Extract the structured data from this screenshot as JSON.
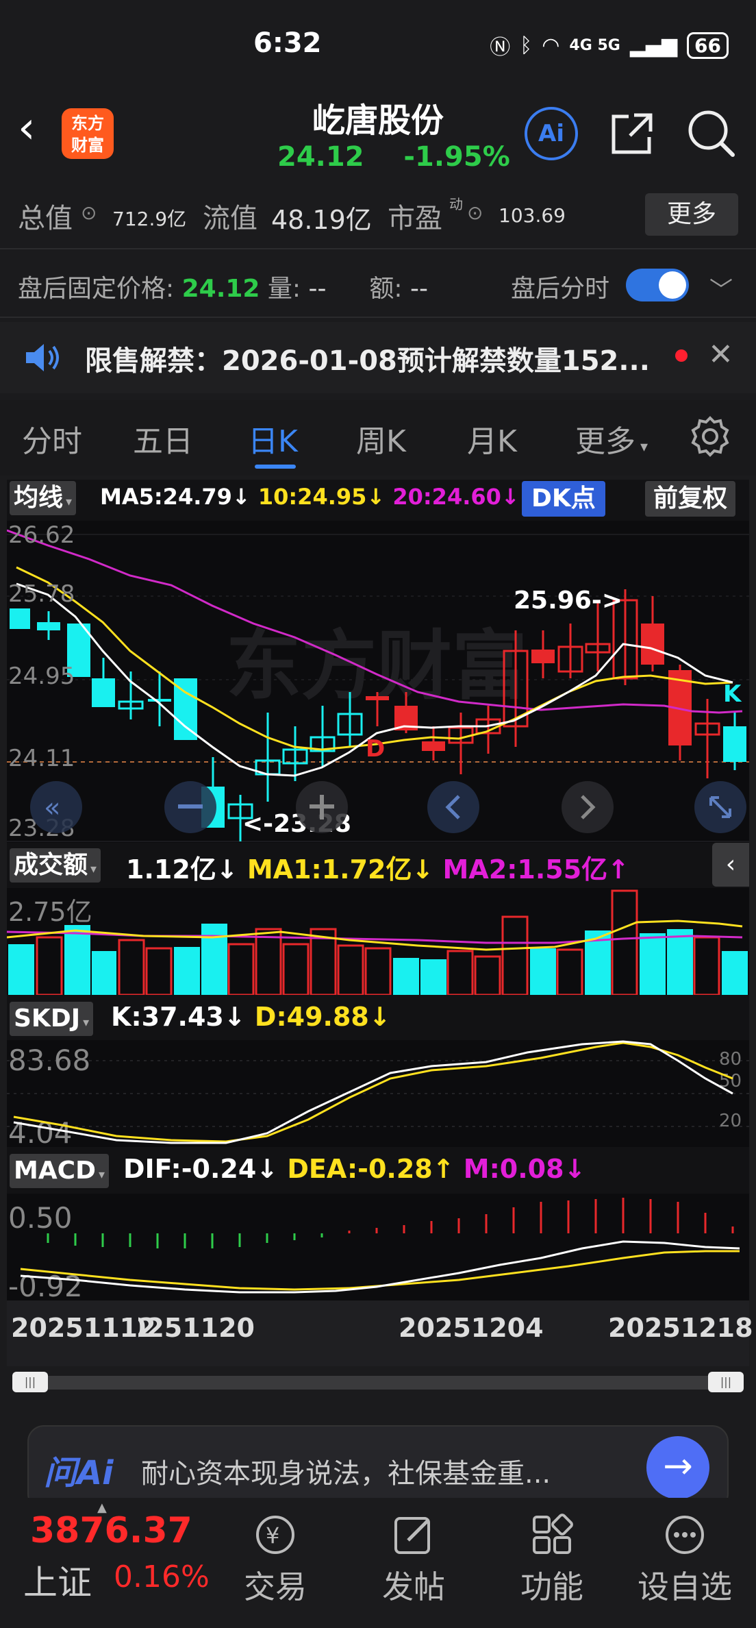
{
  "status_bar": {
    "time": "6:32",
    "network": "4G  5G",
    "battery": "66"
  },
  "header": {
    "stock_name": "屹唐股份",
    "price": "24.12",
    "change_pct": "-1.95%",
    "logo_line1": "东方",
    "logo_line2": "财富",
    "ai_label": "Ai"
  },
  "metrics": {
    "total_value_label": "总值",
    "total_value": "712.9亿",
    "float_value_label": "流值",
    "float_value": "48.19亿",
    "pe_label": "市盈",
    "pe_sup": "动",
    "pe_value": "103.69",
    "more_button": "更多"
  },
  "after_hours": {
    "fixed_price_label": "盘后固定价格:",
    "fixed_price": "24.12",
    "volume_label": "量:",
    "volume": "--",
    "amount_label": "额:",
    "amount": "--",
    "toggle_label": "盘后分时"
  },
  "notice": {
    "text": "限售解禁：2026-01-08预计解禁数量152..."
  },
  "tabs": [
    "分时",
    "五日",
    "日K",
    "周K",
    "月K",
    "更多"
  ],
  "kline_header": {
    "selector": "均线",
    "ma5": "MA5:24.79↓",
    "ma10": "10:24.95↓",
    "ma20": "20:24.60↓",
    "dk_button": "DK点",
    "adj_button": "前复权"
  },
  "kline_labels": {
    "y_top": "26.62",
    "y_2": "25.78",
    "y_3": "24.95",
    "y_4": "24.11",
    "y_bottom": "23.28",
    "high_marker": "25.96->",
    "low_marker": "<-23.28",
    "d_marker": "D",
    "k_marker": "K",
    "watermark": "东方财富"
  },
  "volume_header": {
    "selector": "成交额",
    "value": "1.12亿↓",
    "ma1": "MA1:1.72亿↓",
    "ma2": "MA2:1.55亿↑",
    "y_top": "2.75亿"
  },
  "skdj_header": {
    "selector": "SKDJ",
    "k": "K:37.43↓",
    "d": "D:49.88↓",
    "y_top": "83.68",
    "y_bottom": "4.04",
    "ref_80": "80",
    "ref_50": "50",
    "ref_20": "20"
  },
  "macd_header": {
    "selector": "MACD",
    "dif": "DIF:-0.24↓",
    "dea": "DEA:-0.28↑",
    "m": "M:0.08↓",
    "y_top": "0.50",
    "y_bottom": "-0.92"
  },
  "x_dates": [
    "20251112",
    "20251120",
    "20251204",
    "20251218"
  ],
  "ask_bar": {
    "logo": "问Ai",
    "text": "耐心资本现身说法，社保基金重..."
  },
  "bottom_nav": {
    "index_value": "3876.37",
    "index_name": "上证",
    "index_pct": "0.16%",
    "items": [
      "交易",
      "发帖",
      "功能",
      "设自选"
    ]
  },
  "colors": {
    "up": "#e8282b",
    "down": "#19f0f0",
    "green": "#2ecc4a",
    "accent": "#3b86f5"
  }
}
